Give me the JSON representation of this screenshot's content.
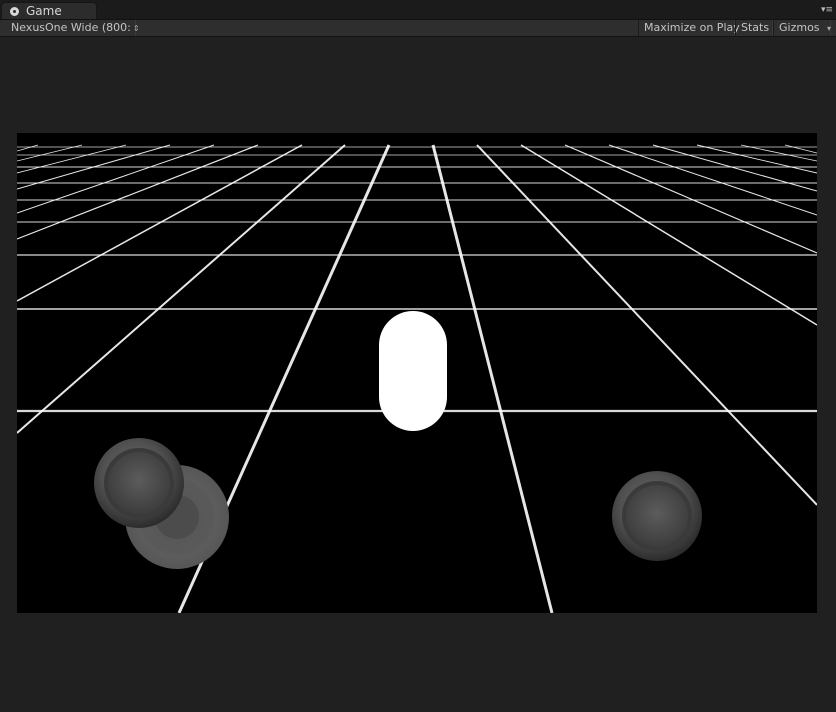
{
  "window": {
    "tab_label": "Game",
    "tab_icon": "game-pacman-icon",
    "menu_icon": "window-menu-icon"
  },
  "toolbar": {
    "aspect_label": "NexusOne Wide (800:",
    "aspect_arrows": "⇕",
    "maximize_label": "Maximize on Play",
    "stats_label": "Stats",
    "gizmos_label": "Gizmos",
    "gizmos_arrow": "▾"
  },
  "scene": {
    "background_color": "#000000",
    "grid_color": "#ffffff",
    "player_color": "#ffffff",
    "objects": [
      "floor-grid",
      "player-capsule",
      "left-joystick",
      "right-joystick"
    ]
  },
  "colors": {
    "editor_bg": "#202020",
    "toolbar_bg": "#2e2e2e"
  }
}
